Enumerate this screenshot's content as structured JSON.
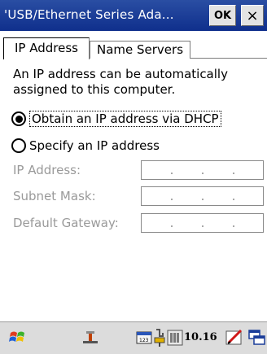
{
  "window": {
    "title": "'USB/Ethernet Series Ada...",
    "ok_label": "OK",
    "close_label": "×"
  },
  "tabs": [
    {
      "label": "IP Address",
      "active": true
    },
    {
      "label": "Name Servers",
      "active": false
    }
  ],
  "main": {
    "description": "An IP address can be automatically assigned to this computer.",
    "options": [
      {
        "label": "Obtain an IP address via DHCP",
        "selected": true
      },
      {
        "label": "Specify an IP address",
        "selected": false
      }
    ],
    "fields": [
      {
        "label": "IP Address:"
      },
      {
        "label": "Subnet Mask:"
      },
      {
        "label": "Default Gateway:"
      }
    ]
  },
  "taskbar": {
    "clock": "10.16",
    "icons": [
      "start-windows-icon",
      "network-icon",
      "input-panel-icon",
      "usb-connector-icon",
      "battery-icon",
      "pen-icon",
      "window-switch-icon"
    ]
  },
  "colors": {
    "titlebar": "#1a3c99",
    "disabled_text": "#9a9a9a",
    "taskbar": "#dcdcdc"
  }
}
